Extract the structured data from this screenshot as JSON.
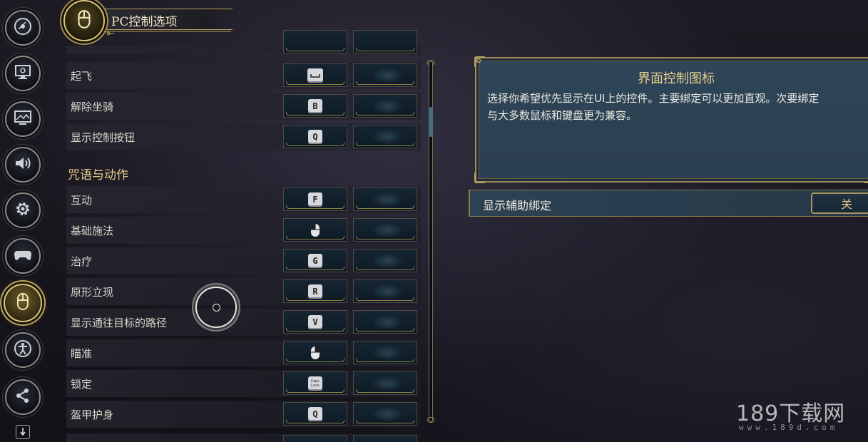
{
  "header": {
    "title": "PC控制选项"
  },
  "sidebar": {
    "items": [
      {
        "icon": "disc-icon"
      },
      {
        "icon": "monitor-icon"
      },
      {
        "icon": "display-image-icon"
      },
      {
        "icon": "speaker-icon"
      },
      {
        "icon": "gear-icon"
      },
      {
        "icon": "gamepad-icon"
      },
      {
        "icon": "mouse-icon",
        "active": true
      },
      {
        "icon": "accessibility-icon"
      },
      {
        "icon": "network-icon"
      }
    ]
  },
  "bindings_top": [
    {
      "label": "起飞",
      "key": "⎵",
      "key_type": "space"
    },
    {
      "label": "解除坐骑",
      "key": "B"
    },
    {
      "label": "显示控制按钮",
      "key": "Q"
    }
  ],
  "section": {
    "title": "咒语与动作"
  },
  "bindings": [
    {
      "label": "互动",
      "key": "F"
    },
    {
      "label": "基础施法",
      "key": "left-mouse-icon",
      "key_type": "mouse-left"
    },
    {
      "label": "治疗",
      "key": "G"
    },
    {
      "label": "原形立现",
      "key": "R"
    },
    {
      "label": "显示通往目标的路径",
      "key": "V"
    },
    {
      "label": "瞄准",
      "key": "right-mouse-icon",
      "key_type": "mouse-right"
    },
    {
      "label": "锁定",
      "key_line1": "Caps",
      "key_line2": "Lock",
      "key_type": "tiny"
    },
    {
      "label": "盔甲护身",
      "key": "Q"
    }
  ],
  "info": {
    "title": "界面控制图标",
    "line1": "选择你希望优先显示在UI上的控件。主要绑定可以更加直观。次要绑定",
    "line2": "与大多数鼠标和键盘更为兼容。"
  },
  "toggle": {
    "label": "显示辅助绑定",
    "value": "关"
  },
  "watermark": {
    "main": "189下载网",
    "sub": "www.189d.com"
  },
  "colors": {
    "accent_gold": "#d9c27a",
    "panel_blue": "#2e4658",
    "heading_gold": "#e3c987"
  }
}
